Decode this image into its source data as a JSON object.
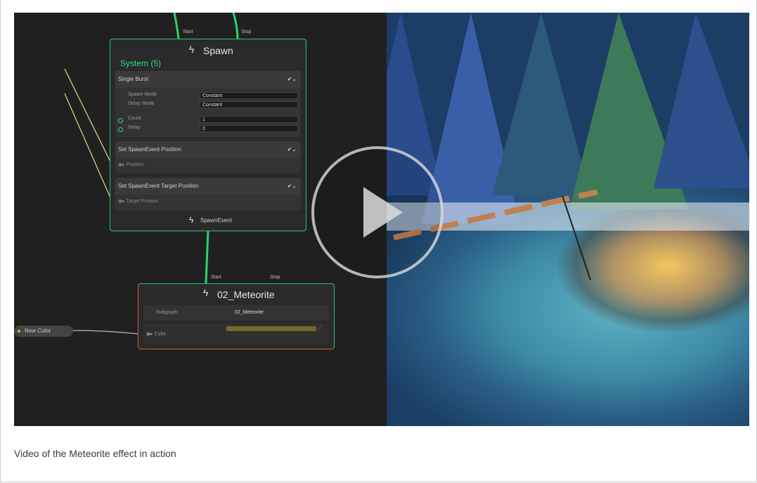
{
  "spawn_node": {
    "start_label": "Start",
    "stop_label": "Stop",
    "title": "Spawn",
    "system_name": "System (5)",
    "single_burst": {
      "label": "Single Burst",
      "spawn_mode_key": "Spawn Mode",
      "spawn_mode_val": "Constant",
      "delay_mode_key": "Delay Mode",
      "delay_mode_val": "Constant",
      "count_key": "Count",
      "count_val": "1",
      "delay_key": "Delay",
      "delay_val": "0"
    },
    "set_position": {
      "label": "Set SpawnEvent Position",
      "port": "Position"
    },
    "set_target": {
      "label": "Set SpawnEvent Target Position",
      "port": "Target Position"
    },
    "output_label": "SpawnEvent"
  },
  "meteorite_node": {
    "start_label": "Start",
    "stop_label": "Stop",
    "title": "02_Meteorite",
    "subgraph_key": "Subgraph",
    "subgraph_val": "02_Meteorite",
    "color_key": "Color"
  },
  "new_color_pill": "New Color",
  "caption": "Video of the Meteorite effect in action",
  "colors": {
    "node_accent": "#27c27a",
    "wire": "#2bd46a",
    "yellow_wire": "#e6e089",
    "meteor_border": "#d05a3a"
  }
}
